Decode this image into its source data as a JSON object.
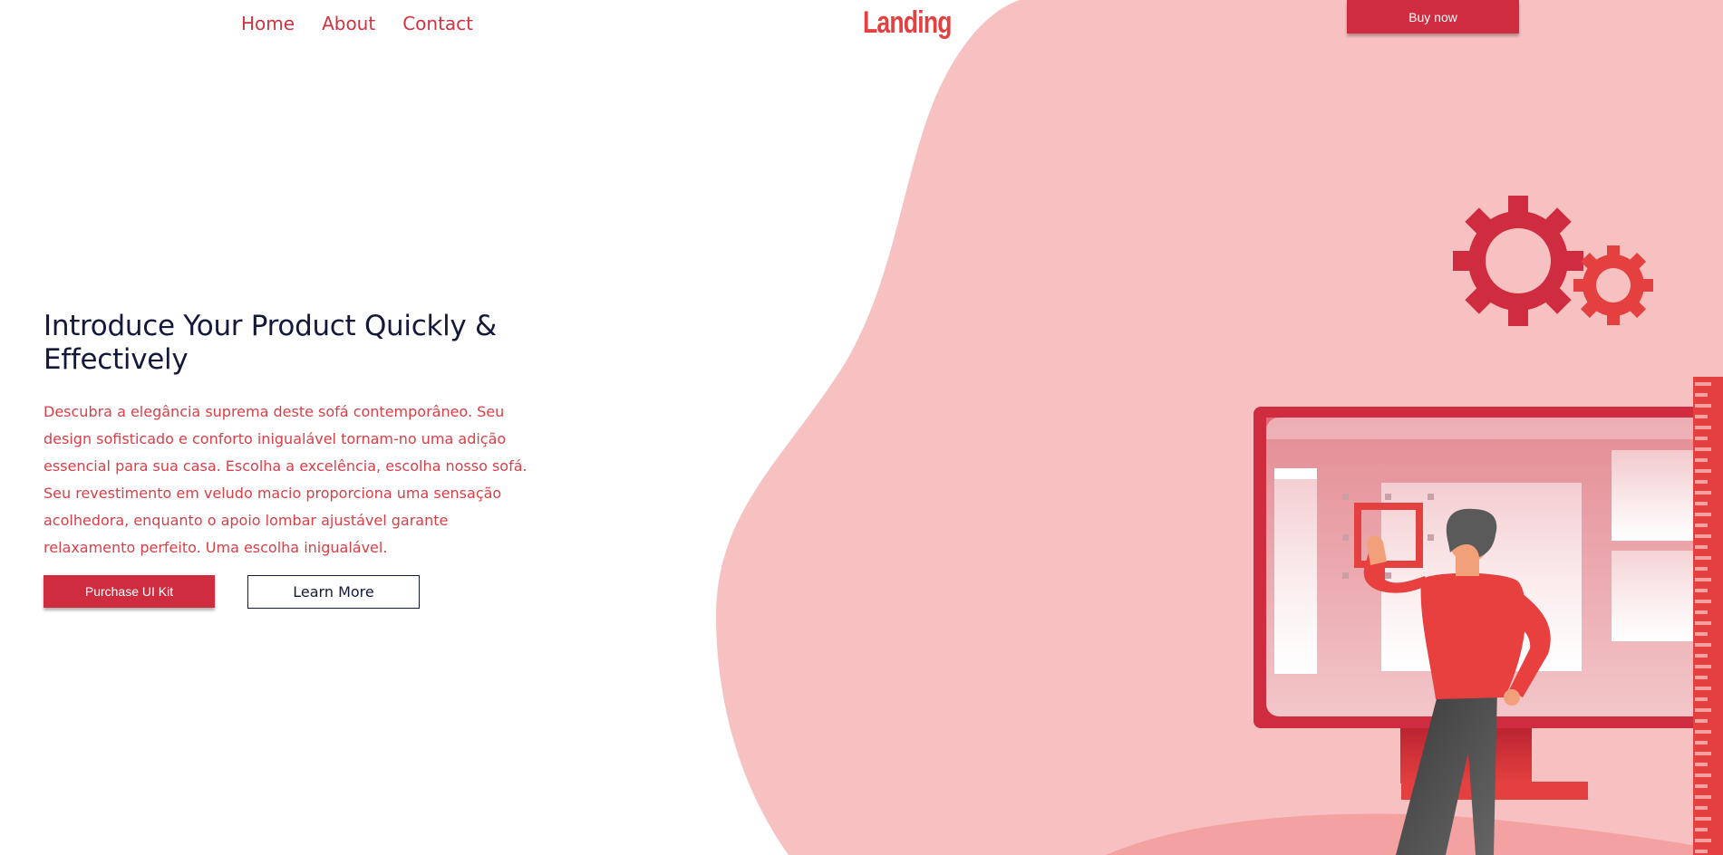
{
  "nav": {
    "links": [
      "Home",
      "About",
      "Contact"
    ],
    "logo": "Landing",
    "buy_button": "Buy now"
  },
  "hero": {
    "title": "Introduce Your Product Quickly & Effectively",
    "description": "Descubra a elegância suprema deste sofá contemporâneo. Seu design sofisticado e conforto inigualável tornam-no uma adição essencial para sua casa. Escolha a excelência, escolha nosso sofá. Seu revestimento em veludo macio proporciona uma sensação acolhedora, enquanto o apoio lombar ajustável garante relaxamento perfeito. Uma escolha inigualável.",
    "primary_button": "Purchase UI Kit",
    "secondary_button": "Learn More"
  },
  "colors": {
    "accent": "#d02c3f",
    "blob": "#f8c1c1",
    "heading": "#14183a",
    "body_text": "#d84048"
  },
  "illustration": {
    "icons": [
      "gear-icon",
      "monitor-icon",
      "person-illustration"
    ]
  }
}
